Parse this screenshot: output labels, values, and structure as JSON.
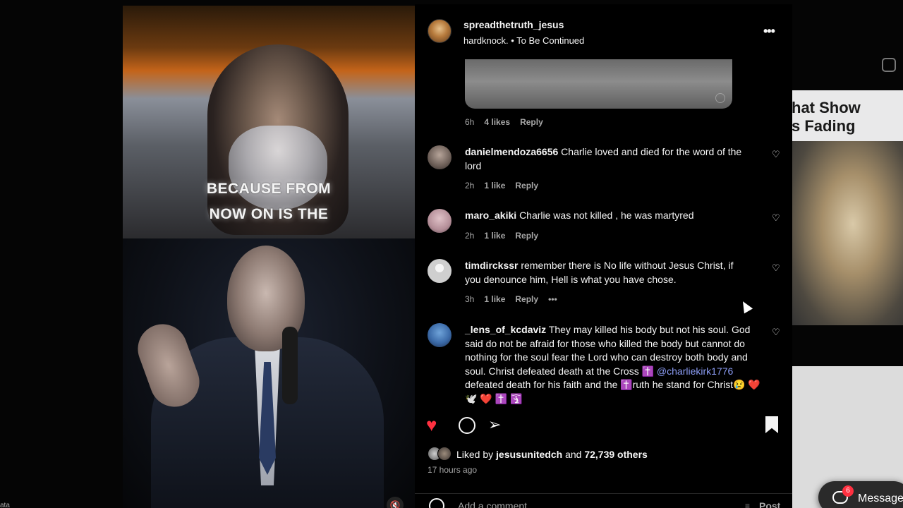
{
  "video": {
    "caption_line1": "BECAUSE FROM",
    "caption_line2": "NOW ON IS THE",
    "mute_icon": "muted-speaker-icon"
  },
  "background": {
    "right_card_text": "hat Show\ns Fading",
    "messages_label": "Message",
    "messages_badge": "6",
    "corner_text": "ata"
  },
  "post": {
    "username": "spreadthetruth_jesus",
    "audio": "hardknock. • To Be Continued",
    "more_icon": "more-options-icon"
  },
  "previous_comment_meta": {
    "time": "6h",
    "likes": "4 likes",
    "reply": "Reply"
  },
  "comments": [
    {
      "username": "danielmendoza6656",
      "text": "Charlie loved and died for the word of the lord",
      "time": "2h",
      "likes": "1 like",
      "reply": "Reply"
    },
    {
      "username": "maro_akiki",
      "text": "Charlie was not killed , he was martyred",
      "time": "2h",
      "likes": "1 like",
      "reply": "Reply"
    },
    {
      "username": "timdirckssr",
      "text": "remember there is No life without Jesus Christ, if you denounce him, Hell is what you have chose.",
      "time": "3h",
      "likes": "1 like",
      "reply": "Reply",
      "more": "•••"
    },
    {
      "username": "_lens_of_kcdaviz",
      "text_part1": "They may killed his body but not his soul. God said do not be afraid for those who killed the body but cannot do nothing for the soul fear the Lord who can destroy both body and soul. Christ defeated death at the Cross ✝️",
      "mention": "@charliekirk1776",
      "text_part2": " defeated death for his faith and the ✝️ruth he stand for Christ😢 ❤️ 🕊️ ❤️ ✝️ 🛐"
    }
  ],
  "actions": {
    "like_icon": "heart-filled-icon",
    "comment_icon": "comment-icon",
    "share_icon": "share-icon",
    "save_icon": "bookmark-filled-icon"
  },
  "likes": {
    "prefix": "Liked by ",
    "user": "jesusunitedch",
    "middle": " and ",
    "others": "72,739 others"
  },
  "time_ago": "17 hours ago",
  "add_comment": {
    "placeholder": "Add a comment...",
    "post_label": "Post"
  },
  "colors": {
    "like_red": "#ff3040",
    "mention_blue": "#8c9df5",
    "muted_text": "#a8a8a8",
    "panel_bg": "#000000"
  }
}
